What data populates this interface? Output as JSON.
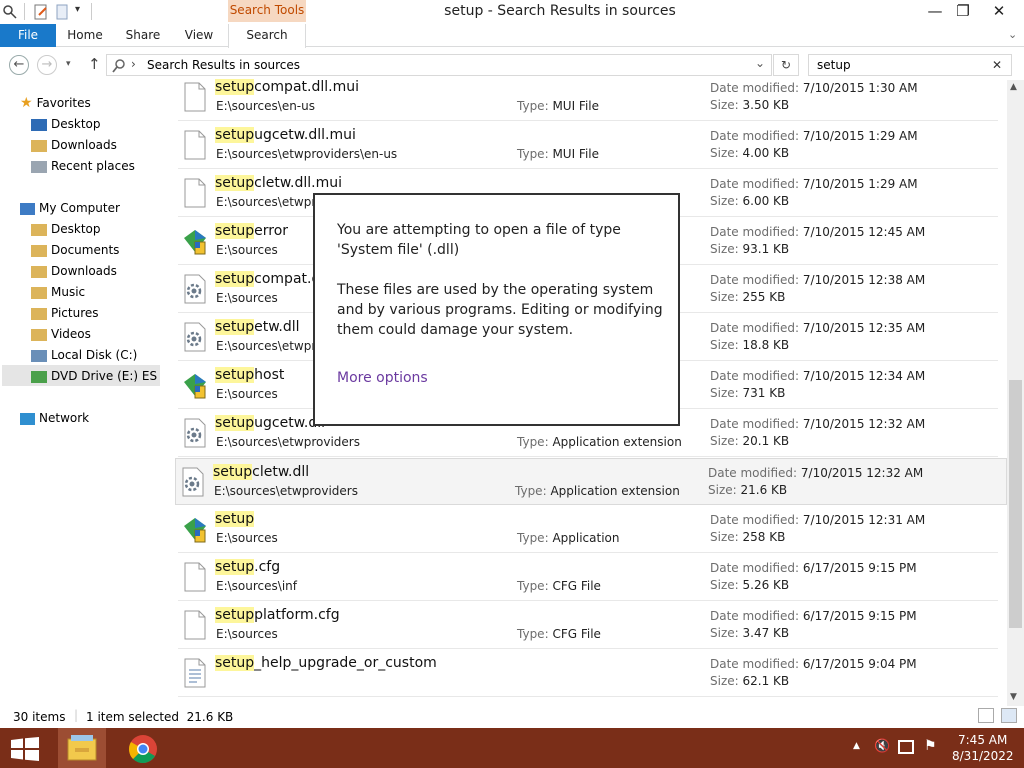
{
  "window": {
    "title": "setup - Search Results in sources",
    "contextual_tab": "Search Tools",
    "controls": {
      "minimize": "—",
      "restore": "❐",
      "close": "✕"
    }
  },
  "ribbon": {
    "tabs": [
      "File",
      "Home",
      "Share",
      "View",
      "Search"
    ]
  },
  "address": {
    "back": "←",
    "forward": "→",
    "up": "↑",
    "breadcrumb_separator": "›",
    "path": "Search Results in sources",
    "dropdown": "⌄",
    "refresh": "↻",
    "search_value": "setup",
    "search_clear": "✕"
  },
  "nav": {
    "favorites": {
      "label": "Favorites",
      "items": [
        "Desktop",
        "Downloads",
        "Recent places"
      ]
    },
    "computer": {
      "label": "My Computer",
      "items": [
        "Desktop",
        "Documents",
        "Downloads",
        "Music",
        "Pictures",
        "Videos",
        "Local Disk (C:)",
        "DVD Drive (E:) ESD-IS"
      ]
    },
    "network": {
      "label": "Network"
    }
  },
  "labels": {
    "type": "Type:",
    "date": "Date modified:",
    "size": "Size:"
  },
  "files": [
    {
      "hl": "setup",
      "rest": "compat.dll.mui",
      "path": "E:\\sources\\en-us",
      "type": "MUI File",
      "date": "7/10/2015 1:30 AM",
      "size": "3.50 KB",
      "icon": "doc"
    },
    {
      "hl": "setup",
      "rest": "ugcetw.dll.mui",
      "path": "E:\\sources\\etwproviders\\en-us",
      "type": "MUI File",
      "date": "7/10/2015 1:29 AM",
      "size": "4.00 KB",
      "icon": "doc"
    },
    {
      "hl": "setup",
      "rest": "cletw.dll.mui",
      "path": "E:\\sources\\etwpro",
      "type": "",
      "date": "7/10/2015 1:29 AM",
      "size": "6.00 KB",
      "icon": "doc"
    },
    {
      "hl": "setup",
      "rest": "error",
      "path": "E:\\sources",
      "type": "",
      "date": "7/10/2015 12:45 AM",
      "size": "93.1 KB",
      "icon": "app"
    },
    {
      "hl": "setup",
      "rest": "compat.d",
      "path": "E:\\sources",
      "type": "",
      "date": "7/10/2015 12:38 AM",
      "size": "255 KB",
      "icon": "gear"
    },
    {
      "hl": "setup",
      "rest": "etw.dll",
      "path": "E:\\sources\\etwpro",
      "type": "",
      "date": "7/10/2015 12:35 AM",
      "size": "18.8 KB",
      "icon": "gear"
    },
    {
      "hl": "setup",
      "rest": "host",
      "path": "E:\\sources",
      "type": "",
      "date": "7/10/2015 12:34 AM",
      "size": "731 KB",
      "icon": "app"
    },
    {
      "hl": "setup",
      "rest": "ugcetw.dll",
      "path": "E:\\sources\\etwproviders",
      "type": "Application extension",
      "date": "7/10/2015 12:32 AM",
      "size": "20.1 KB",
      "icon": "gear"
    },
    {
      "hl": "setup",
      "rest": "cletw.dll",
      "path": "E:\\sources\\etwproviders",
      "type": "Application extension",
      "date": "7/10/2015 12:32 AM",
      "size": "21.6 KB",
      "icon": "gear",
      "selected": true
    },
    {
      "hl": "setup",
      "rest": "",
      "path": "E:\\sources",
      "type": "Application",
      "date": "7/10/2015 12:31 AM",
      "size": "258 KB",
      "icon": "app"
    },
    {
      "hl": "setup",
      "rest": ".cfg",
      "path": "E:\\sources\\inf",
      "type": "CFG File",
      "date": "6/17/2015 9:15 PM",
      "size": "5.26 KB",
      "icon": "doc"
    },
    {
      "hl": "setup",
      "rest": "platform.cfg",
      "path": "E:\\sources",
      "type": "CFG File",
      "date": "6/17/2015 9:15 PM",
      "size": "3.47 KB",
      "icon": "doc"
    },
    {
      "hl": "setup",
      "rest": "_help_upgrade_or_custom",
      "path": "",
      "type": "",
      "date": "6/17/2015 9:04 PM",
      "size": "62.1 KB",
      "icon": "text"
    }
  ],
  "popup": {
    "line1": "You are attempting to open a file of type 'System file' (.dll)",
    "line2": "These files are used by the operating system and by various programs. Editing or modifying them could damage your system.",
    "link": "More options"
  },
  "status": {
    "count": "30 items",
    "selected": "1 item selected  21.6 KB"
  },
  "taskbar": {
    "time": "7:45 AM",
    "date": "8/31/2022",
    "tray_up": "▲"
  },
  "colors": {
    "file_tab": "#1979ca",
    "search_tools": "#f6d8c1",
    "highlight": "#fdf69b",
    "link": "#6b3aa0",
    "taskbar": "#7a2e18"
  }
}
